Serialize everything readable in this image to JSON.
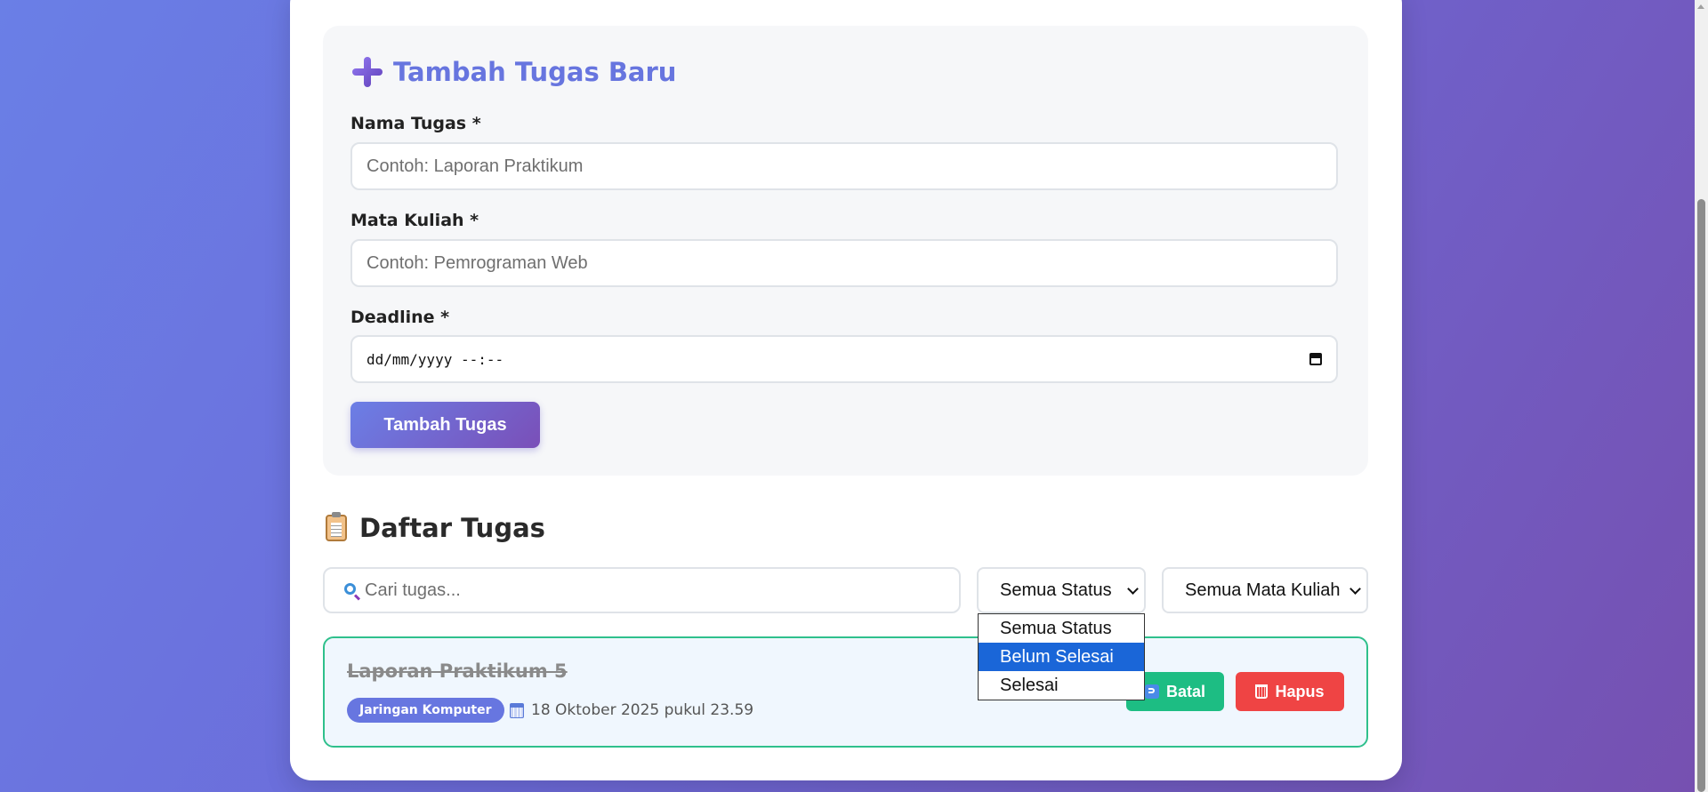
{
  "form": {
    "title": "Tambah Tugas Baru",
    "title_icon": "plus-icon",
    "task_name_label": "Nama Tugas *",
    "task_name_placeholder": "Contoh: Laporan Praktikum",
    "course_label": "Mata Kuliah *",
    "course_placeholder": "Contoh: Pemrograman Web",
    "deadline_label": "Deadline *",
    "deadline_placeholder": "dd/mm/yyyy --:--",
    "submit_label": "Tambah Tugas"
  },
  "list": {
    "title": "Daftar Tugas",
    "title_icon": "clipboard-icon",
    "search_placeholder": "Cari tugas...",
    "status_filter_value": "Semua Status",
    "course_filter_value": "Semua Mata Kuliah",
    "status_options": [
      {
        "label": "Semua Status",
        "highlighted": false
      },
      {
        "label": "Belum Selesai",
        "highlighted": true
      },
      {
        "label": "Selesai",
        "highlighted": false
      }
    ],
    "tasks": [
      {
        "name": "Laporan Praktikum 5",
        "course": "Jaringan Komputer",
        "deadline": "18 Oktober 2025 pukul 23.59",
        "completed": true,
        "undo_label": "Batal",
        "delete_label": "Hapus"
      }
    ]
  },
  "colors": {
    "accent": "#6775df",
    "completed_border": "#2fc08c",
    "undo_button": "#1dbd83",
    "delete_button": "#ef4444",
    "dropdown_highlight": "#1a66d8"
  }
}
